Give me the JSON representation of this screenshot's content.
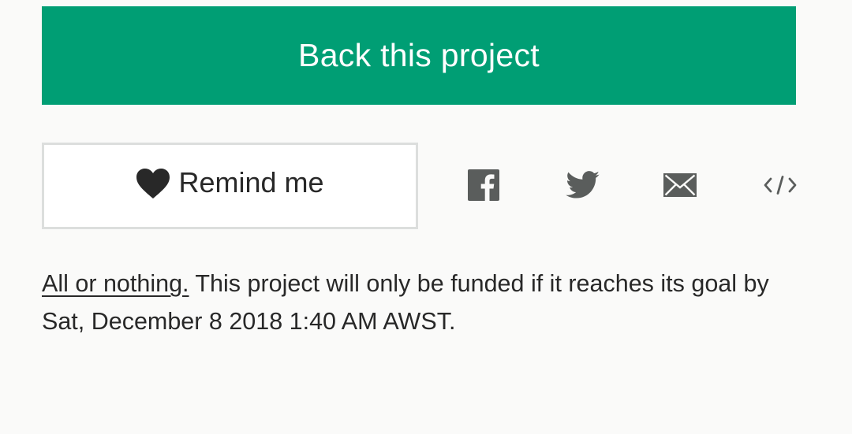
{
  "primary_cta": {
    "label": "Back this project"
  },
  "remind": {
    "label": "Remind me",
    "icon": "heart-icon"
  },
  "share": {
    "items": [
      {
        "name": "facebook",
        "icon": "facebook-icon"
      },
      {
        "name": "twitter",
        "icon": "twitter-icon"
      },
      {
        "name": "email",
        "icon": "mail-icon"
      },
      {
        "name": "embed",
        "icon": "embed-code-icon"
      }
    ]
  },
  "funding_note": {
    "link_text": "All or nothing.",
    "text": " This project will only be funded if it reaches its goal by Sat, December 8 2018 1:40 AM AWST."
  },
  "colors": {
    "primary": "#009e74",
    "text": "#282828",
    "icon": "#5a5d5c",
    "background": "#fafaf9",
    "border": "#dcdedd"
  }
}
